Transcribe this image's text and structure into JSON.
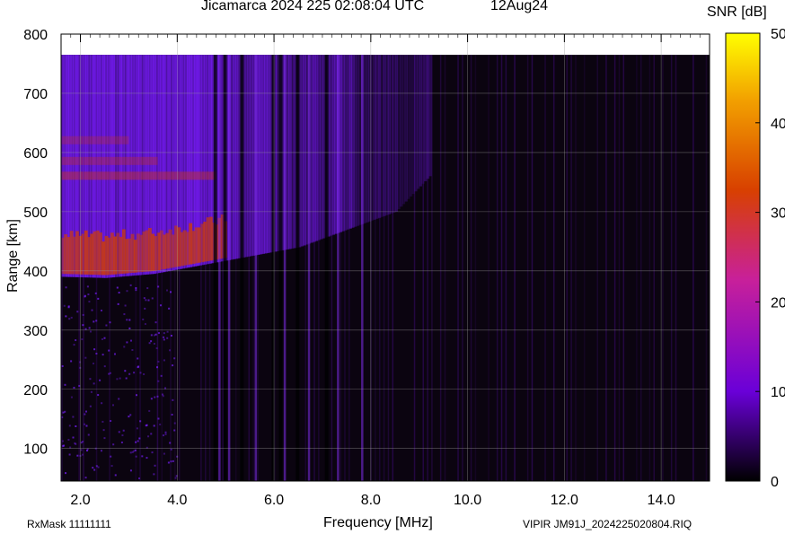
{
  "header": {
    "title": "Jicamarca 2024 225 02:08:04 UTC",
    "date": "12Aug24"
  },
  "footer": {
    "rxmask": "RxMask 11111111",
    "filename": "VIPIR  JM91J_2024225020804.RIQ"
  },
  "chart_data": {
    "type": "heatmap",
    "title": "Jicamarca 2024 225 02:08:04 UTC",
    "xlabel": "Frequency [MHz]",
    "ylabel": "Range [km]",
    "colorbar_label": "SNR [dB]",
    "xlim": [
      1.6,
      15.0
    ],
    "ylim": [
      45,
      800
    ],
    "data_top_range": 765,
    "x_ticks": [
      2.0,
      4.0,
      6.0,
      8.0,
      10.0,
      12.0,
      14.0
    ],
    "x_tick_labels": [
      "2.0",
      "4.0",
      "6.0",
      "8.0",
      "10.0",
      "12.0",
      "14.0"
    ],
    "y_ticks": [
      100,
      200,
      300,
      400,
      500,
      600,
      700,
      800
    ],
    "y_tick_labels": [
      "100",
      "200",
      "300",
      "400",
      "500",
      "600",
      "700",
      "800"
    ],
    "colorbar_range": [
      0,
      50
    ],
    "colorbar_ticks": [
      0,
      10,
      20,
      30,
      40,
      50
    ],
    "colorbar_tick_labels": [
      "0",
      "10",
      "20",
      "30",
      "40",
      "50"
    ],
    "grid": true,
    "echo_trace": [
      {
        "freq": 1.6,
        "range": 390,
        "snr": 30
      },
      {
        "freq": 2.5,
        "range": 388,
        "snr": 30
      },
      {
        "freq": 3.5,
        "range": 395,
        "snr": 28
      },
      {
        "freq": 4.5,
        "range": 410,
        "snr": 27
      },
      {
        "freq": 5.5,
        "range": 425,
        "snr": 18
      },
      {
        "freq": 6.5,
        "range": 440,
        "snr": 15
      },
      {
        "freq": 7.5,
        "range": 470,
        "snr": 12
      },
      {
        "freq": 8.5,
        "range": 500,
        "snr": 10
      },
      {
        "freq": 9.2,
        "range": 560,
        "snr": 9
      }
    ]
  }
}
